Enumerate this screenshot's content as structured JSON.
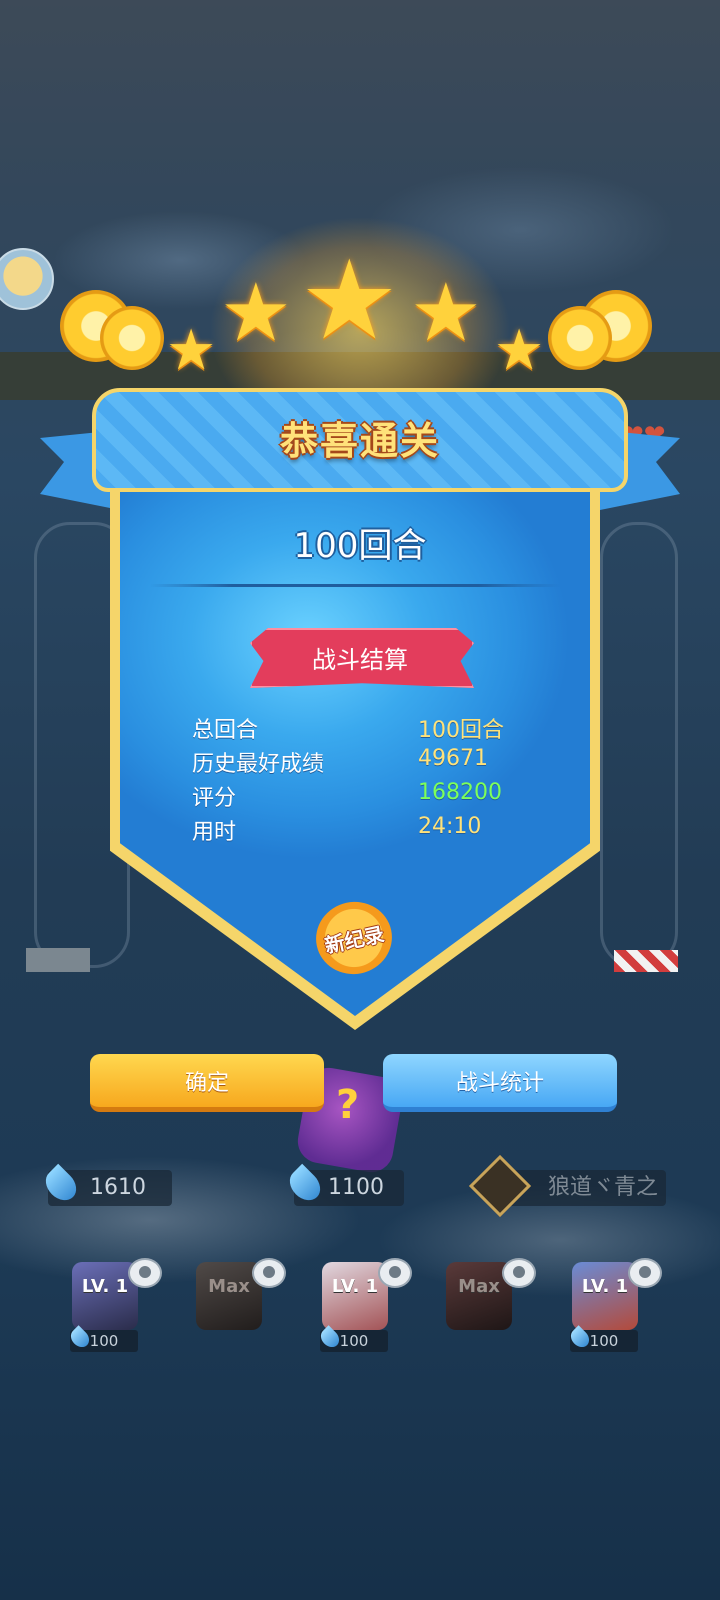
{
  "panel": {
    "title": "恭喜通关",
    "rounds_heading": "100回合",
    "section_ribbon": "战斗结算",
    "new_record_badge": "新纪录",
    "stats": [
      {
        "label": "总回合",
        "value": "100回合"
      },
      {
        "label": "历史最好成绩",
        "value": "49671"
      },
      {
        "label": "评分",
        "value": "168200"
      },
      {
        "label": "用时",
        "value": "24:10"
      }
    ]
  },
  "buttons": {
    "confirm": "确定",
    "battle_stats": "战斗统计"
  },
  "resources": {
    "left_value": "1610",
    "center_value": "1100",
    "player_name": "狼道ヾ青之"
  },
  "cards": [
    {
      "level": "LV. 1",
      "cost": "100"
    },
    {
      "level": "Max",
      "cost": ""
    },
    {
      "level": "LV. 1",
      "cost": "100"
    },
    {
      "level": "Max",
      "cost": ""
    },
    {
      "level": "LV. 1",
      "cost": "100"
    }
  ],
  "colors": {
    "accent_gold": "#ffe27a",
    "score_green": "#7dff5a",
    "confirm_button": "#f7a81e",
    "stats_button": "#48a8f4",
    "ribbon_red": "#e33d5c"
  },
  "icons": [
    "star-icon",
    "trumpet-icon",
    "water-drop-icon",
    "eye-icon",
    "dice-icon",
    "rank-badge-icon",
    "avatar-icon",
    "heart-icon"
  ]
}
